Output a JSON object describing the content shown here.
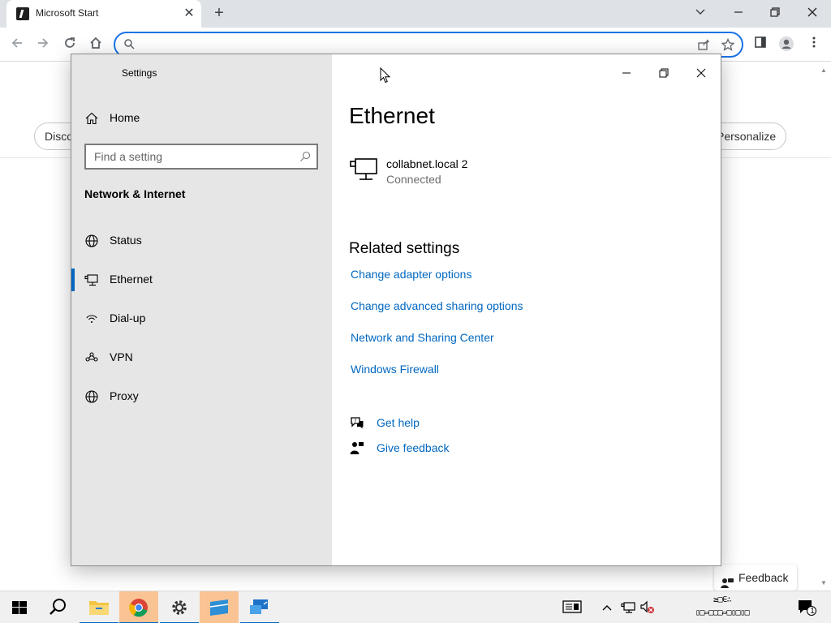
{
  "browser": {
    "tab_title": "Microsoft Start",
    "tab_close": "✕",
    "new_tab": "+",
    "address_value": "",
    "page": {
      "discover_label": "Disco",
      "personalize_label": "Personalize",
      "feedback_label": "Feedback"
    }
  },
  "settings": {
    "window_title": "Settings",
    "nav": {
      "home_label": "Home",
      "search_placeholder": "Find a setting",
      "section_title": "Network & Internet",
      "items": [
        {
          "label": "Status",
          "icon": "globe-icon"
        },
        {
          "label": "Ethernet",
          "icon": "ethernet-icon",
          "selected": true
        },
        {
          "label": "Dial-up",
          "icon": "dialup-icon"
        },
        {
          "label": "VPN",
          "icon": "vpn-icon"
        },
        {
          "label": "Proxy",
          "icon": "globe-icon"
        }
      ]
    },
    "content": {
      "heading": "Ethernet",
      "network_name": "collabnet.local 2",
      "network_status": "Connected",
      "related_heading": "Related settings",
      "links": [
        "Change adapter options",
        "Change advanced sharing options",
        "Network and Sharing Center",
        "Windows Firewall"
      ],
      "get_help": "Get help",
      "give_feedback": "Give feedback"
    }
  },
  "taskbar": {
    "notification_count": "1",
    "clock_line1": "≥□∈∴",
    "clock_line2": "▯□▱□▢□▱□▯□▯□"
  },
  "colors": {
    "accent": "#0067c0",
    "link": "#0067c0",
    "sidebar_bg": "#e6e6e6",
    "omnibox_border": "#1a73e8",
    "taskbar_highlight": "#f9c394"
  }
}
